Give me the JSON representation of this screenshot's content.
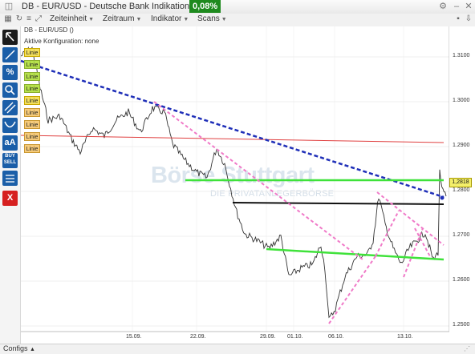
{
  "window": {
    "title": "DB - EUR/USD - Deutsche Bank Indikation",
    "change_badge": "0,08%"
  },
  "menu": [
    {
      "label": "Zeiteinheit"
    },
    {
      "label": "Zeitraum"
    },
    {
      "label": "Indikator"
    },
    {
      "label": "Scans"
    }
  ],
  "chart": {
    "info_line1": "DB - EUR/USD ()",
    "info_line2": "Aktive Konfiguration: none",
    "current_price": "1,2818",
    "tags": [
      "Linie",
      "Linie",
      "Linie",
      "Linie",
      "Linie",
      "Linie",
      "Linie",
      "Linie",
      "Linie"
    ],
    "watermark": "Börse Stuttgart",
    "watermark_sub": "DIE PRIVATANLEGERBÖRSE",
    "colors": {
      "downtrend": "#1f2fb8",
      "support": "#3fe23a",
      "pink": "#f07ac8",
      "horizontal_red": "#e04040",
      "price": "#333333"
    }
  },
  "chart_data": {
    "type": "line",
    "x_ticks": [
      "15.09.",
      "22.09.",
      "29.09.",
      "01.10.",
      "06.10.",
      "13.10."
    ],
    "y_ticks": [
      "1.3100",
      "1.3000",
      "1.2900",
      "1.2800",
      "1.2700",
      "1.2600",
      "1.2500"
    ],
    "ylim": [
      1.2485,
      1.3175
    ],
    "grid": true
  },
  "status": {
    "configs_label": "Configs"
  }
}
